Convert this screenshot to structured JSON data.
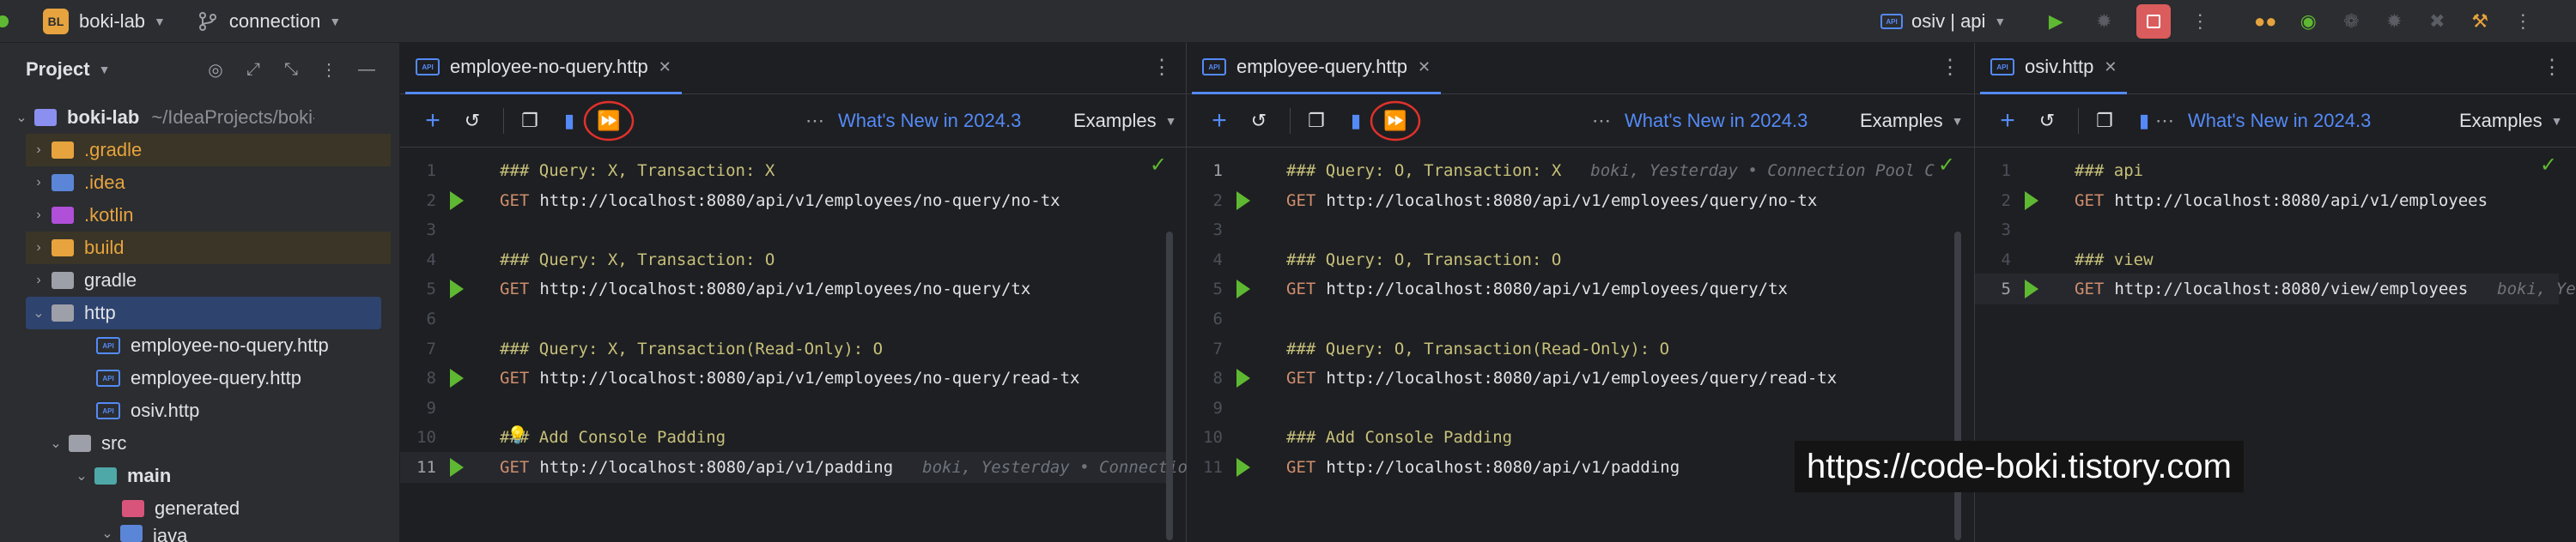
{
  "titlebar": {
    "project_badge": "BL",
    "project_name": "boki-lab",
    "branch": "connection",
    "run_config": "osiv | api"
  },
  "sidebar": {
    "title": "Project",
    "root": {
      "name": "boki-lab",
      "path": "~/IdeaProjects/boki-lab"
    },
    "items": [
      {
        "label": ".gradle"
      },
      {
        "label": ".idea"
      },
      {
        "label": ".kotlin"
      },
      {
        "label": "build"
      },
      {
        "label": "gradle"
      },
      {
        "label": "http"
      },
      {
        "label": "employee-no-query.http"
      },
      {
        "label": "employee-query.http"
      },
      {
        "label": "osiv.http"
      },
      {
        "label": "src"
      },
      {
        "label": "main"
      },
      {
        "label": "generated"
      },
      {
        "label": "java"
      }
    ]
  },
  "toolbar": {
    "whats_new": "What's New in 2024.3",
    "examples": "Examples"
  },
  "panes": [
    {
      "tab": "employee-no-query.http",
      "lines": [
        {
          "n": "1",
          "type": "comment",
          "text": "### Query: X, Transaction: X"
        },
        {
          "n": "2",
          "type": "get",
          "method": "GET",
          "url": "http://localhost:8080/api/v1/employees/no-query/no-tx"
        },
        {
          "n": "3",
          "type": "empty"
        },
        {
          "n": "4",
          "type": "comment",
          "text": "### Query: X, Transaction: O"
        },
        {
          "n": "5",
          "type": "get",
          "method": "GET",
          "url": "http://localhost:8080/api/v1/employees/no-query/tx"
        },
        {
          "n": "6",
          "type": "empty"
        },
        {
          "n": "7",
          "type": "comment",
          "text": "### Query: X, Transaction(Read-Only): O"
        },
        {
          "n": "8",
          "type": "get",
          "method": "GET",
          "url": "http://localhost:8080/api/v1/employees/no-query/read-tx"
        },
        {
          "n": "9",
          "type": "empty"
        },
        {
          "n": "10",
          "type": "comment",
          "text": "### Add Console Padding"
        },
        {
          "n": "11",
          "type": "get",
          "method": "GET",
          "url": "http://localhost:8080/api/v1/padding",
          "inlay": "boki, Yesterday • Connectio"
        }
      ]
    },
    {
      "tab": "employee-query.http",
      "lines": [
        {
          "n": "1",
          "type": "comment",
          "text": "### Query: O, Transaction: X",
          "inlay": "boki, Yesterday • Connection Pool C"
        },
        {
          "n": "2",
          "type": "get",
          "method": "GET",
          "url": "http://localhost:8080/api/v1/employees/query/no-tx"
        },
        {
          "n": "3",
          "type": "empty"
        },
        {
          "n": "4",
          "type": "comment",
          "text": "### Query: O, Transaction: O"
        },
        {
          "n": "5",
          "type": "get",
          "method": "GET",
          "url": "http://localhost:8080/api/v1/employees/query/tx"
        },
        {
          "n": "6",
          "type": "empty"
        },
        {
          "n": "7",
          "type": "comment",
          "text": "### Query: O, Transaction(Read-Only): O"
        },
        {
          "n": "8",
          "type": "get",
          "method": "GET",
          "url": "http://localhost:8080/api/v1/employees/query/read-tx"
        },
        {
          "n": "9",
          "type": "empty"
        },
        {
          "n": "10",
          "type": "comment",
          "text": "### Add Console Padding"
        },
        {
          "n": "11",
          "type": "get",
          "method": "GET",
          "url": "http://localhost:8080/api/v1/padding"
        }
      ]
    },
    {
      "tab": "osiv.http",
      "lines": [
        {
          "n": "1",
          "type": "comment",
          "text": "### api"
        },
        {
          "n": "2",
          "type": "get",
          "method": "GET",
          "url": "http://localhost:8080/api/v1/employees"
        },
        {
          "n": "3",
          "type": "empty"
        },
        {
          "n": "4",
          "type": "comment",
          "text": "### view"
        },
        {
          "n": "5",
          "type": "get",
          "method": "GET",
          "url": "http://localhost:8080/view/employees",
          "inlay": "boki, Ye"
        }
      ]
    }
  ],
  "watermark": "https://code-boki.tistory.com",
  "colors": {
    "accent": "#548af7",
    "run": "#5fb832",
    "comment": "#c6c07a",
    "keyword": "#cf8e6d",
    "highlight_circle": "#e0312b"
  }
}
